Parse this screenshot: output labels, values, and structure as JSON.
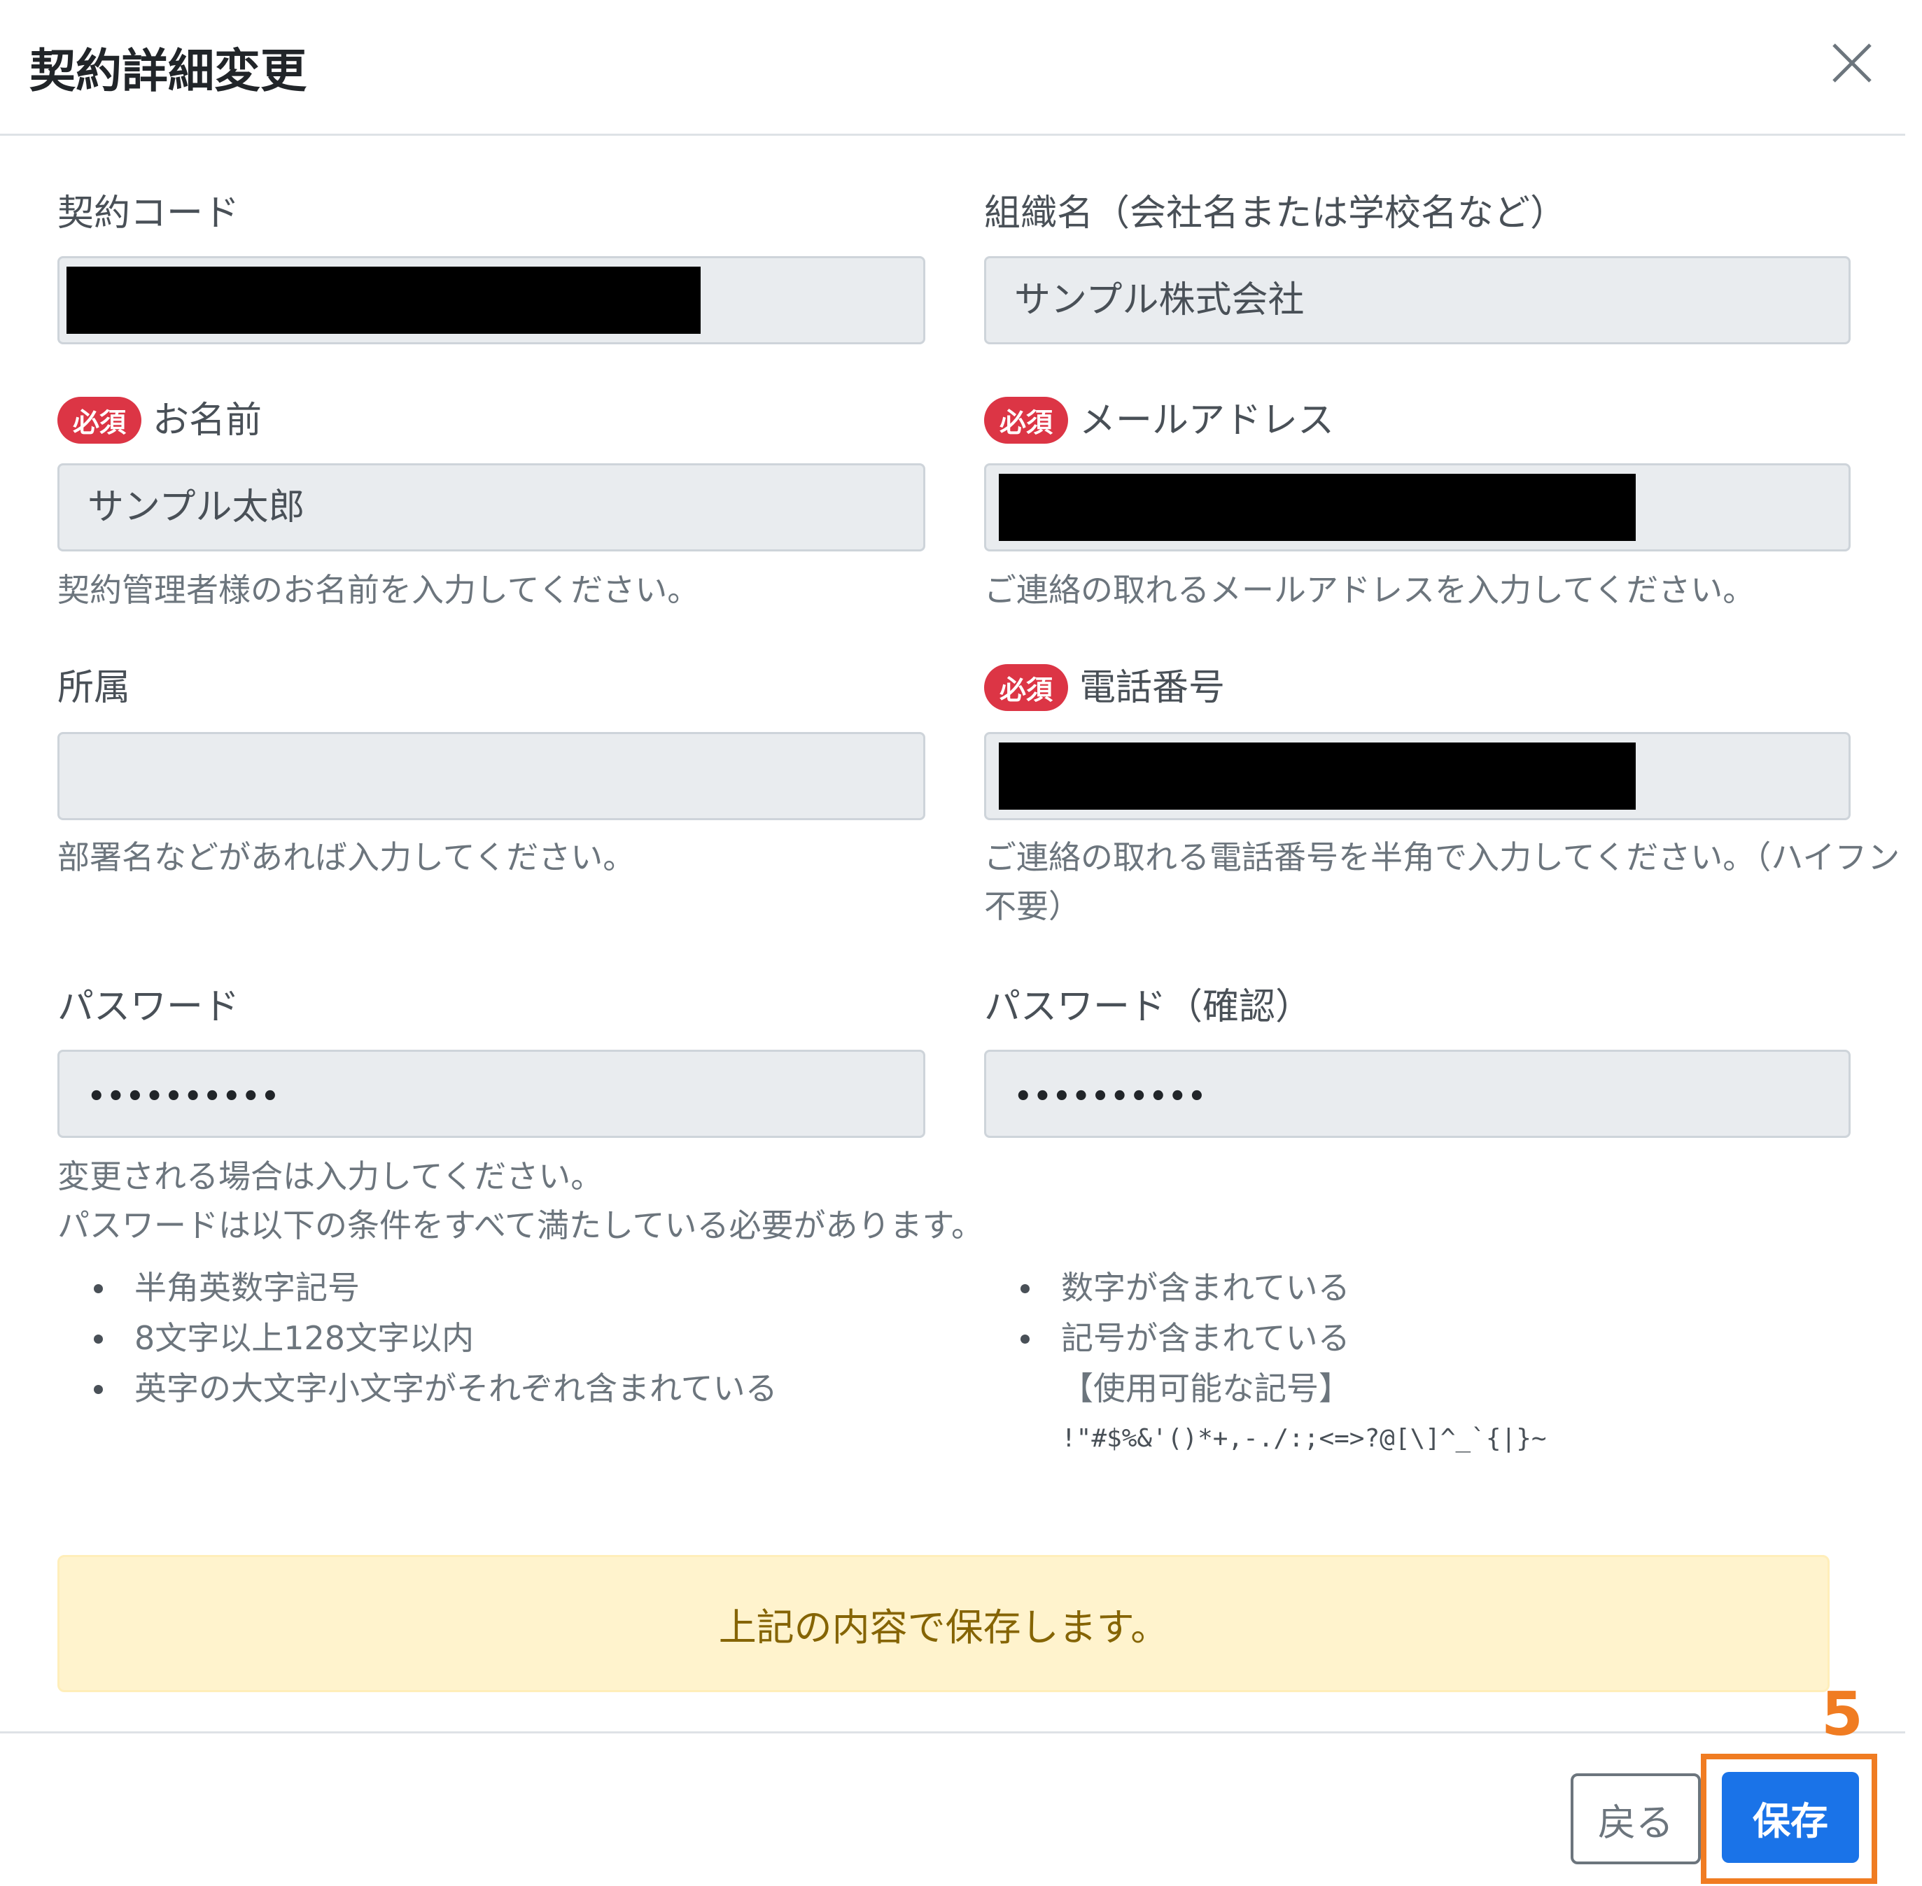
{
  "header": {
    "title": "契約詳細変更",
    "close_icon": "close-icon"
  },
  "required_badge": "必須",
  "contract_code": {
    "label": "契約コード",
    "value": ""
  },
  "org_name": {
    "label": "組織名（会社名または学校名など）",
    "value": "サンプル株式会社"
  },
  "name": {
    "label": "お名前",
    "value": "サンプル太郎",
    "help": "契約管理者様のお名前を入力してください。"
  },
  "email": {
    "label": "メールアドレス",
    "value": "",
    "help": "ご連絡の取れるメールアドレスを入力してください。"
  },
  "department": {
    "label": "所属",
    "value": "",
    "help": "部署名などがあれば入力してください。"
  },
  "phone": {
    "label": "電話番号",
    "value": "",
    "help_line1": "ご連絡の取れる電話番号を半角で入力してください。（ハイフン",
    "help_line2": "不要）"
  },
  "password": {
    "label": "パスワード",
    "value": "••••••••••",
    "help_line1": "変更される場合は入力してください。",
    "help_line2": "パスワードは以下の条件をすべて満たしている必要があります。",
    "rules_left": [
      "半角英数字記号",
      "8文字以上128文字以内",
      "英字の大文字小文字がそれぞれ含まれている"
    ],
    "rules_right": [
      "数字が含まれている",
      "記号が含まれている"
    ],
    "allowed_symbols_label": "【使用可能な記号】",
    "allowed_symbols": "!\"#$%&'()*+,-./:;<=>?@[\\]^_`{|}~"
  },
  "password_confirm": {
    "label": "パスワード（確認）",
    "value": "••••••••••"
  },
  "alert": {
    "text": "上記の内容で保存します。"
  },
  "footer": {
    "back_label": "戻る",
    "save_label": "保存"
  },
  "annotation": {
    "step_number": "5",
    "color": "#f07c22"
  },
  "colors": {
    "primary": "#1a73e8",
    "danger": "#dc3545",
    "alert_bg": "#fff3cd"
  }
}
